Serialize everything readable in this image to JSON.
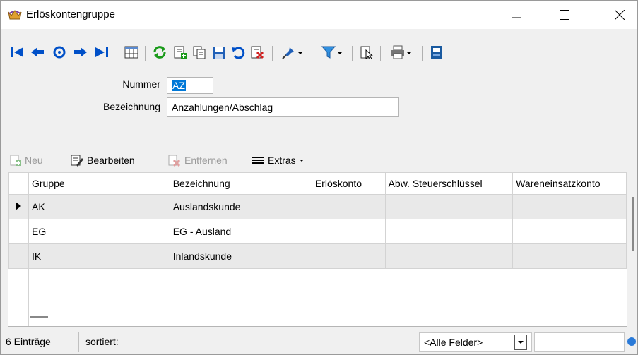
{
  "window": {
    "title": "Erlöskontengruppe",
    "accent": "#0050c8"
  },
  "toolbar": {
    "icons": [
      "first-record-icon",
      "prev-record-icon",
      "refresh-record-icon",
      "next-record-icon",
      "last-record-icon",
      "table-view-icon",
      "reload-icon",
      "new-record-icon",
      "copy-record-icon",
      "save-icon",
      "undo-icon",
      "delete-icon",
      "pin-icon",
      "filter-icon",
      "selection-icon",
      "print-icon",
      "layout-icon"
    ]
  },
  "form": {
    "nummer_label": "Nummer",
    "nummer_value": "AZ",
    "bezeichnung_label": "Bezeichnung",
    "bezeichnung_value": "Anzahlungen/Abschlag"
  },
  "subtoolbar": {
    "neu": "Neu",
    "bearbeiten": "Bearbeiten",
    "entfernen": "Entfernen",
    "extras": "Extras"
  },
  "grid": {
    "columns": [
      "Gruppe",
      "Bezeichnung",
      "Erlöskonto",
      "Abw. Steuerschlüssel",
      "Wareneinsatzkonto"
    ],
    "rows": [
      {
        "gruppe": "AK",
        "bezeichnung": "Auslandskunde",
        "erloeskonto": "",
        "steuer": "",
        "waren": ""
      },
      {
        "gruppe": "EG",
        "bezeichnung": "EG - Ausland",
        "erloeskonto": "",
        "steuer": "",
        "waren": ""
      },
      {
        "gruppe": "IK",
        "bezeichnung": "Inlandskunde",
        "erloeskonto": "",
        "steuer": "",
        "waren": ""
      }
    ]
  },
  "status": {
    "count": "6 Einträge",
    "sort": "sortiert:",
    "field_select": "<Alle Felder>"
  }
}
